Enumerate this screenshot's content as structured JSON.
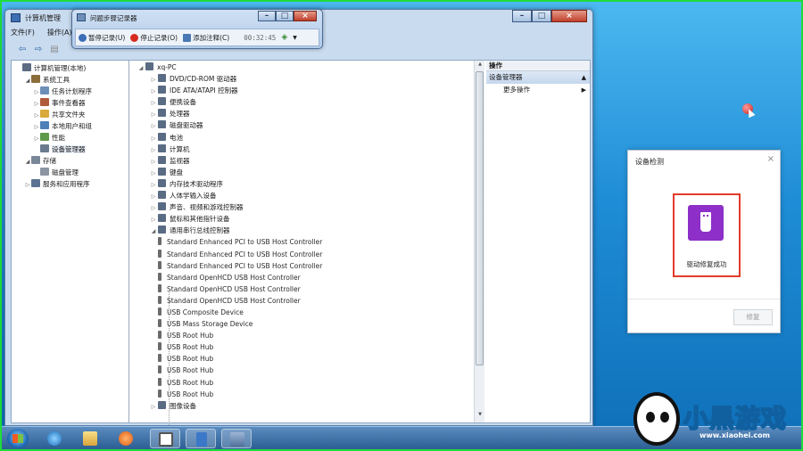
{
  "mmc": {
    "title": "计算机管理",
    "menu": [
      "文件(F)",
      "操作(A)"
    ]
  },
  "left_tree": [
    {
      "label": "计算机管理(本地)",
      "indent": 0,
      "arrow": "",
      "icon": "computer-management-icon",
      "color": "#5b6b82"
    },
    {
      "label": "系统工具",
      "indent": 1,
      "arrow": "◢",
      "icon": "tools-icon",
      "color": "#8b6d3a"
    },
    {
      "label": "任务计划程序",
      "indent": 2,
      "arrow": "▷",
      "icon": "clock-icon",
      "color": "#6c8fb8"
    },
    {
      "label": "事件查看器",
      "indent": 2,
      "arrow": "▷",
      "icon": "event-viewer-icon",
      "color": "#b05a3a"
    },
    {
      "label": "共享文件夹",
      "indent": 2,
      "arrow": "▷",
      "icon": "shared-folder-icon",
      "color": "#d9a93a"
    },
    {
      "label": "本地用户和组",
      "indent": 2,
      "arrow": "▷",
      "icon": "users-icon",
      "color": "#4f7fb8"
    },
    {
      "label": "性能",
      "indent": 2,
      "arrow": "▷",
      "icon": "performance-icon",
      "color": "#5d9a4a"
    },
    {
      "label": "设备管理器",
      "indent": 2,
      "arrow": "",
      "icon": "device-manager-icon",
      "color": "#6a7a8e",
      "selected": true
    },
    {
      "label": "存储",
      "indent": 1,
      "arrow": "◢",
      "icon": "storage-icon",
      "color": "#7a8799"
    },
    {
      "label": "磁盘管理",
      "indent": 2,
      "arrow": "",
      "icon": "disk-icon",
      "color": "#8c95a3"
    },
    {
      "label": "服务和应用程序",
      "indent": 1,
      "arrow": "▷",
      "icon": "services-icon",
      "color": "#5b7393"
    }
  ],
  "device_tree": [
    {
      "label": "xq-PC",
      "type": "root"
    },
    {
      "label": "DVD/CD-ROM 驱动器",
      "type": "cat"
    },
    {
      "label": "IDE ATA/ATAPI 控制器",
      "type": "cat"
    },
    {
      "label": "便携设备",
      "type": "cat"
    },
    {
      "label": "处理器",
      "type": "cat"
    },
    {
      "label": "磁盘驱动器",
      "type": "cat"
    },
    {
      "label": "电池",
      "type": "cat"
    },
    {
      "label": "计算机",
      "type": "cat"
    },
    {
      "label": "监视器",
      "type": "cat"
    },
    {
      "label": "键盘",
      "type": "cat"
    },
    {
      "label": "内存技术驱动程序",
      "type": "cat"
    },
    {
      "label": "人体学输入设备",
      "type": "cat"
    },
    {
      "label": "声音、视频和游戏控制器",
      "type": "cat"
    },
    {
      "label": "鼠标和其他指针设备",
      "type": "cat"
    },
    {
      "label": "通用串行总线控制器",
      "type": "open"
    },
    {
      "label": "Standard Enhanced PCI to USB Host Controller",
      "type": "child"
    },
    {
      "label": "Standard Enhanced PCI to USB Host Controller",
      "type": "child"
    },
    {
      "label": "Standard Enhanced PCI to USB Host Controller",
      "type": "child"
    },
    {
      "label": "Standard OpenHCD USB Host Controller",
      "type": "child"
    },
    {
      "label": "Standard OpenHCD USB Host Controller",
      "type": "child"
    },
    {
      "label": "Standard OpenHCD USB Host Controller",
      "type": "child"
    },
    {
      "label": "USB Composite Device",
      "type": "child"
    },
    {
      "label": "USB Mass Storage Device",
      "type": "child"
    },
    {
      "label": "USB Root Hub",
      "type": "child"
    },
    {
      "label": "USB Root Hub",
      "type": "child"
    },
    {
      "label": "USB Root Hub",
      "type": "child"
    },
    {
      "label": "USB Root Hub",
      "type": "child"
    },
    {
      "label": "USB Root Hub",
      "type": "child"
    },
    {
      "label": "USB Root Hub",
      "type": "child"
    },
    {
      "label": "图像设备",
      "type": "cat"
    }
  ],
  "actions": {
    "header": "操作",
    "section": "设备管理器",
    "more": "更多操作"
  },
  "psr": {
    "title": "问题步骤记录器",
    "pause": "暂停记录(U)",
    "stop": "停止记录(O)",
    "comment": "添加注释(C)",
    "timer": "00:32:45"
  },
  "dialog": {
    "title": "设备检测",
    "close": "×",
    "message": "驱动修复成功",
    "button": "修复"
  },
  "watermark": {
    "text": "小黑游戏",
    "url": "www.xiaohei.com"
  },
  "colors": {
    "accent": "#8d2fc8",
    "highlight_frame": "#e23b2c",
    "desktop": "#1e8cd6"
  }
}
